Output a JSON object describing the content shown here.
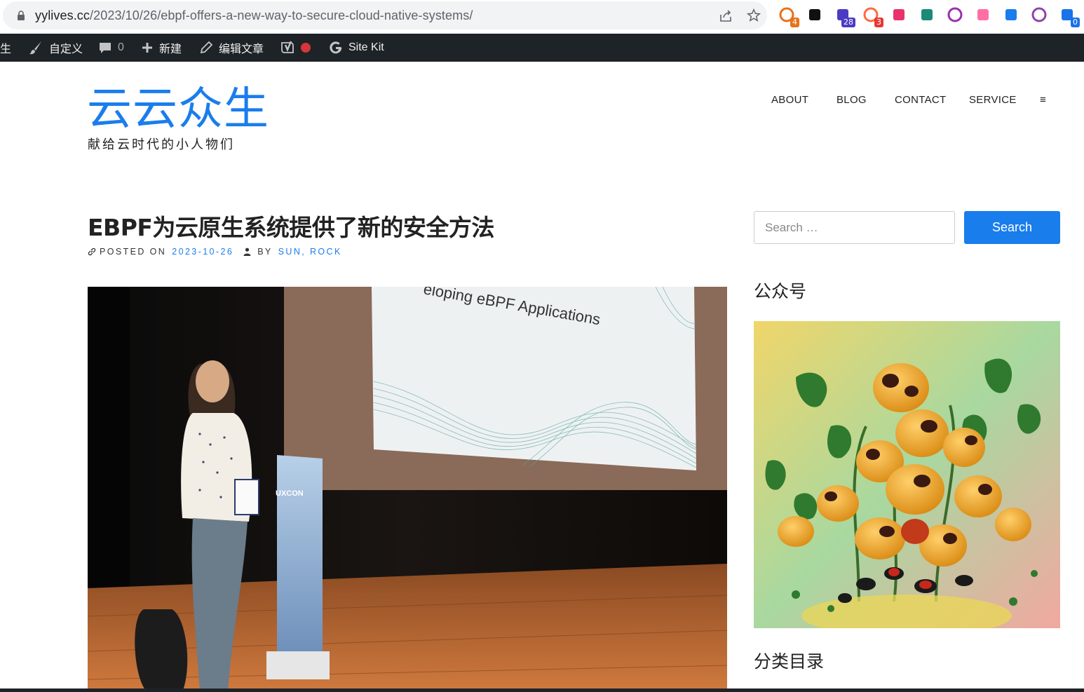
{
  "browser": {
    "url_domain": "yylives.cc",
    "url_path": "/2023/10/26/ebpf-offers-a-new-way-to-secure-cloud-native-systems/",
    "extensions": [
      {
        "name": "ext-1",
        "badge": "4",
        "color": "#e8711a",
        "badge_color": "#e8711a"
      },
      {
        "name": "notion",
        "badge": "",
        "color": "#111111"
      },
      {
        "name": "ext-3",
        "badge": "28",
        "color": "#4b3bc4",
        "badge_color": "#4b3bc4"
      },
      {
        "name": "ext-4",
        "badge": "3",
        "color": "#ff6a3d",
        "badge_color": "#e53935"
      },
      {
        "name": "translate",
        "badge": "",
        "color": "#e8336d"
      },
      {
        "name": "ext-6",
        "badge": "",
        "color": "#1b8a78"
      },
      {
        "name": "ext-7",
        "badge": "",
        "color": "#9b2fae"
      },
      {
        "name": "ext-8",
        "badge": "",
        "color": "#ff6fa5"
      },
      {
        "name": "ext-9",
        "badge": "",
        "color": "#1a7dec"
      },
      {
        "name": "openai",
        "badge": "",
        "color": "#8e44ad"
      },
      {
        "name": "ext-11",
        "badge": "0",
        "color": "#1a73e8",
        "badge_color": "#1a73e8"
      }
    ]
  },
  "adminbar": {
    "site_partial": "生",
    "customize": "自定义",
    "comments_count": "0",
    "new": "新建",
    "edit_post": "编辑文章",
    "site_kit": "Site Kit"
  },
  "header": {
    "site_title": "云云众生",
    "site_description": "献给云时代的小人物们",
    "nav": [
      "ABOUT",
      "BLOG",
      "CONTACT",
      "SERVICE",
      "≡"
    ]
  },
  "post": {
    "title": "EBPF为云原生系统提供了新的安全方法",
    "posted_on_label": "POSTED ON",
    "date": "2023-10-26",
    "by_label": "BY",
    "authors": "SUN, ROCK",
    "image_text": "eloping eBPF Applications",
    "image_text_small": "UXCON"
  },
  "sidebar": {
    "search_placeholder": "Search …",
    "search_button": "Search",
    "widget1_title": "公众号",
    "widget2_title": "分类目录"
  },
  "colors": {
    "accent": "#1a7dec",
    "adminbar": "#1d2327"
  }
}
